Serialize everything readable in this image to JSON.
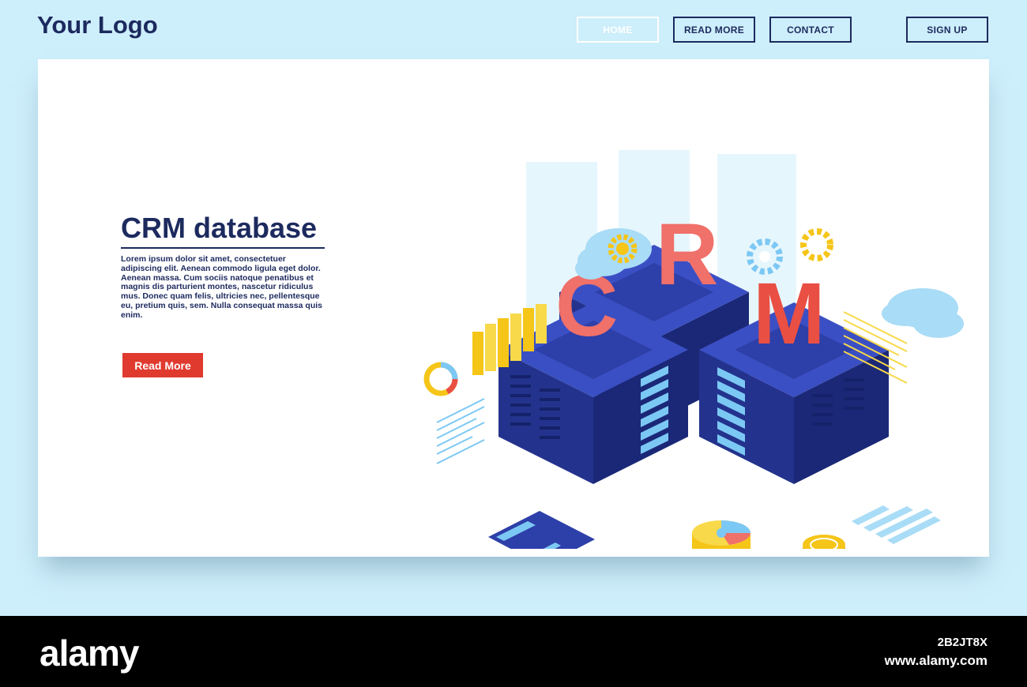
{
  "header": {
    "logo": "Your Logo",
    "nav": {
      "home": "HOME",
      "read_more": "READ MORE",
      "contact": "CONTACT",
      "sign_up": "SIGN UP"
    }
  },
  "hero": {
    "title": "CRM database",
    "body": "Lorem ipsum dolor sit amet, consectetuer adipiscing elit. Aenean commodo ligula eget dolor. Aenean massa. Cum sociis natoque penatibus et magnis dis parturient montes, nascetur ridiculus mus. Donec quam felis, ultricies nec, pellentesque eu, pretium quis, sem. Nulla consequat massa quis enim.",
    "cta_label": "Read More"
  },
  "illustration": {
    "letters": [
      "C",
      "R",
      "M"
    ],
    "icons": [
      "server-icon",
      "cloud-icon",
      "gear-icon",
      "bar-chart-icon",
      "donut-chart-icon",
      "pie-chart-icon",
      "credit-card-icon",
      "coin-icon"
    ]
  },
  "footer": {
    "brand": "alamy",
    "image_id": "2B2JT8X",
    "url": "www.alamy.com"
  },
  "colors": {
    "background": "#cdeefb",
    "navy": "#1c2a5e",
    "accent_red": "#e03a2f",
    "server_blue": "#2d3fa8"
  }
}
